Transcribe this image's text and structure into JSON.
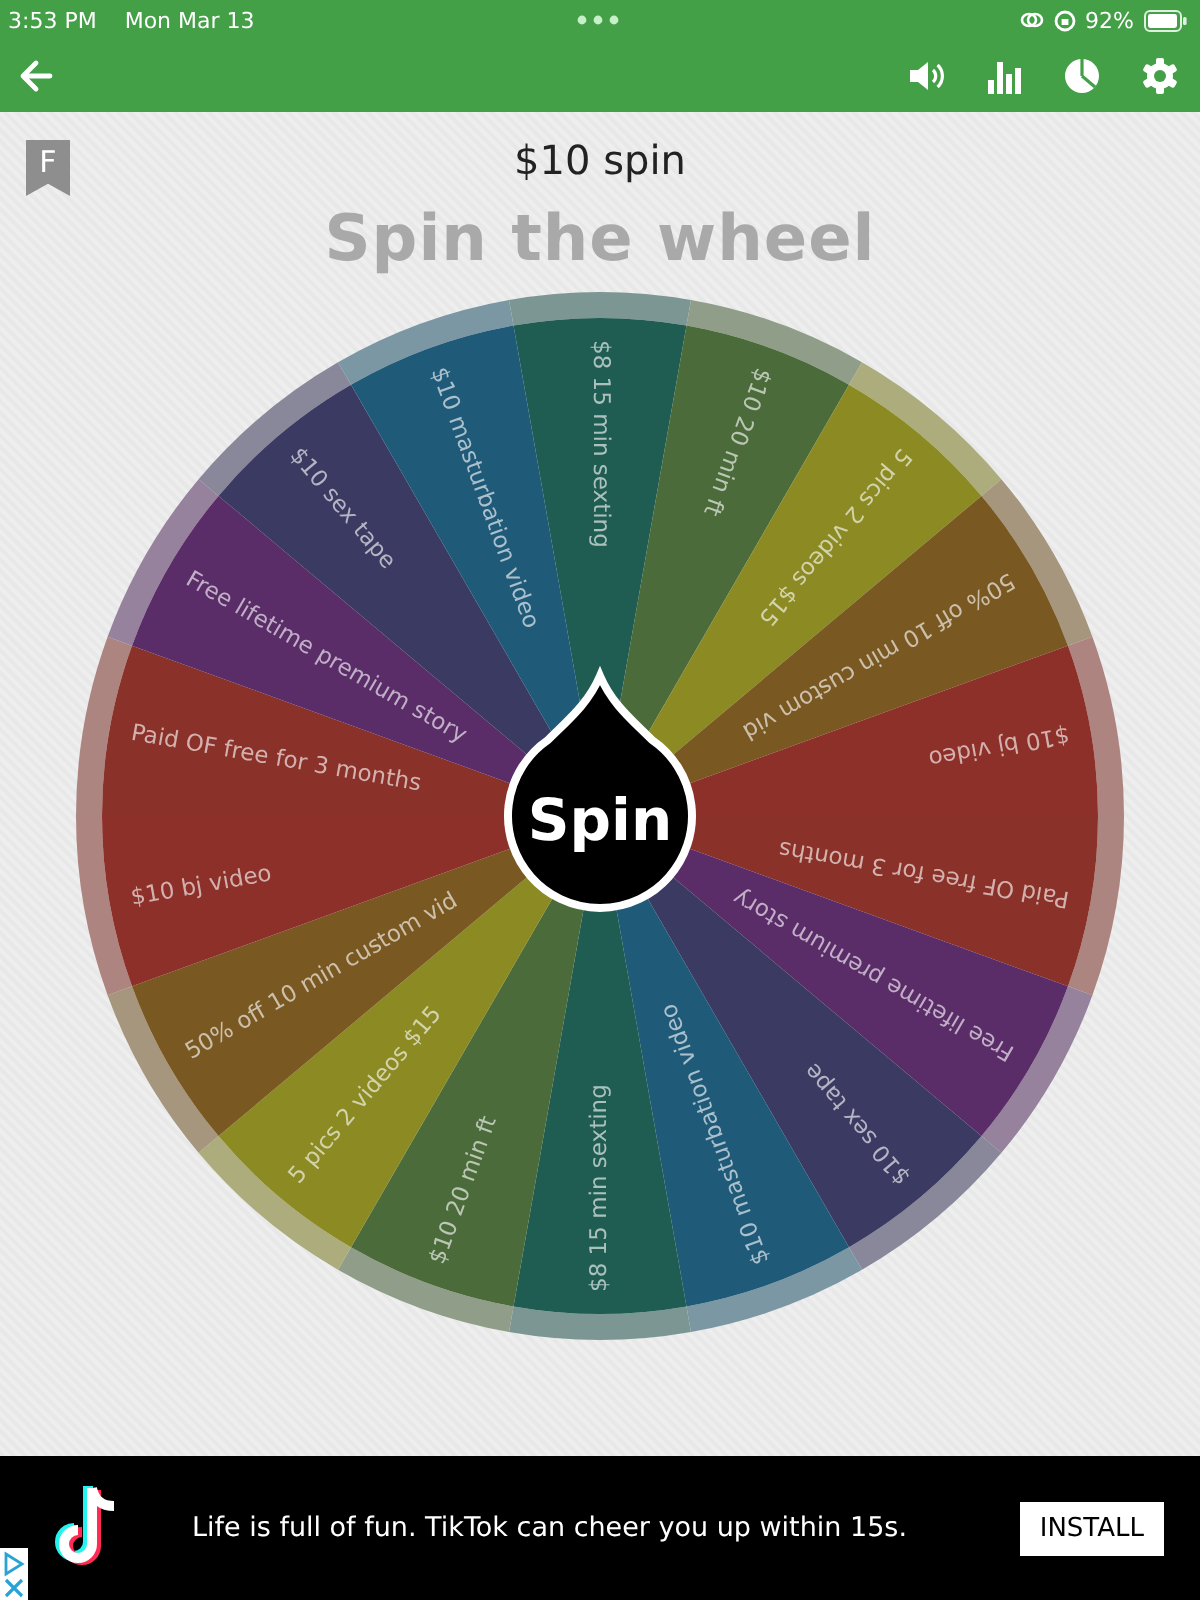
{
  "status_bar": {
    "time": "3:53 PM",
    "date": "Mon Mar 13",
    "battery": "92%"
  },
  "bookmark": {
    "letter": "F"
  },
  "subtitle": "$10 spin",
  "title": "Spin the wheel",
  "wheel": {
    "spin_label": "Spin",
    "segments": [
      {
        "label": "$8 15 min sexting",
        "color": "#1f5c52"
      },
      {
        "label": "$10 20 min ft",
        "color": "#4b6b3b"
      },
      {
        "label": "5 pics 2 videos $15",
        "color": "#8c8a22"
      },
      {
        "label": "50% off 10 min custom vid",
        "color": "#7a5822"
      },
      {
        "label": "$10 bj video",
        "color": "#8c3029"
      },
      {
        "label": "Paid OF free for 3 months",
        "color": "#8a3229"
      },
      {
        "label": "Free lifetime premium story",
        "color": "#5a2c68"
      },
      {
        "label": "$10 sex tape",
        "color": "#3b3a62"
      },
      {
        "label": "$10 masturbation video",
        "color": "#1f5a78"
      },
      {
        "label": "$8 15 min sexting",
        "color": "#1f5c52"
      },
      {
        "label": "$10 20 min ft",
        "color": "#4b6b3b"
      },
      {
        "label": "5 pics 2 videos $15",
        "color": "#8c8a22"
      },
      {
        "label": "50% off 10 min custom vid",
        "color": "#7a5822"
      },
      {
        "label": "$10 bj video",
        "color": "#8c3029"
      },
      {
        "label": "Paid OF free for 3 months",
        "color": "#8a3229"
      },
      {
        "label": "Free lifetime premium story",
        "color": "#5a2c68"
      },
      {
        "label": "$10 sex tape",
        "color": "#3b3a62"
      },
      {
        "label": "$10 masturbation video",
        "color": "#1f5a78"
      }
    ]
  },
  "ad": {
    "text": "Life is full of fun. TikTok can cheer you up within 15s.",
    "button": "INSTALL"
  }
}
